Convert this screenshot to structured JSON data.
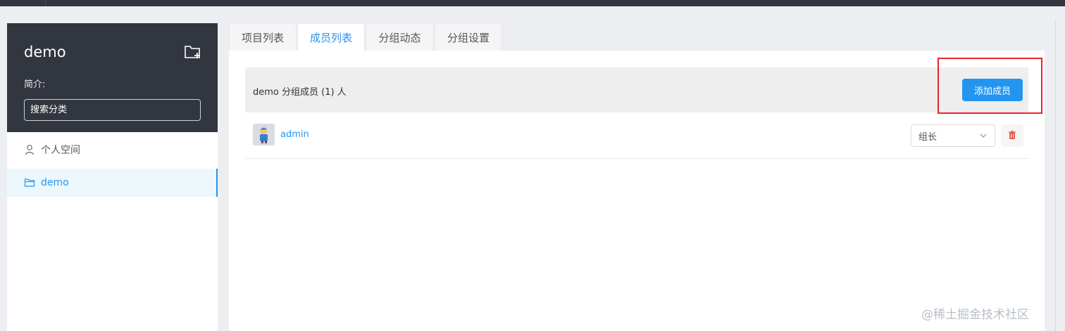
{
  "sidebar": {
    "group_name": "demo",
    "intro_label": "简介:",
    "search_placeholder": "搜索分类",
    "items": [
      {
        "label": "个人空间",
        "icon": "user-icon"
      },
      {
        "label": "demo",
        "icon": "folder-icon"
      }
    ]
  },
  "tabs": [
    {
      "label": "项目列表"
    },
    {
      "label": "成员列表"
    },
    {
      "label": "分组动态"
    },
    {
      "label": "分组设置"
    }
  ],
  "members": {
    "header_text": "demo 分组成员 (1) 人",
    "add_button": "添加成员",
    "rows": [
      {
        "name": "admin",
        "role": "组长"
      }
    ]
  },
  "watermark": "@稀土掘金技术社区",
  "colors": {
    "accent": "#2395f1",
    "sidebar_dark": "#32363f",
    "highlight": "#e8242a",
    "delete": "#e85c4a"
  }
}
